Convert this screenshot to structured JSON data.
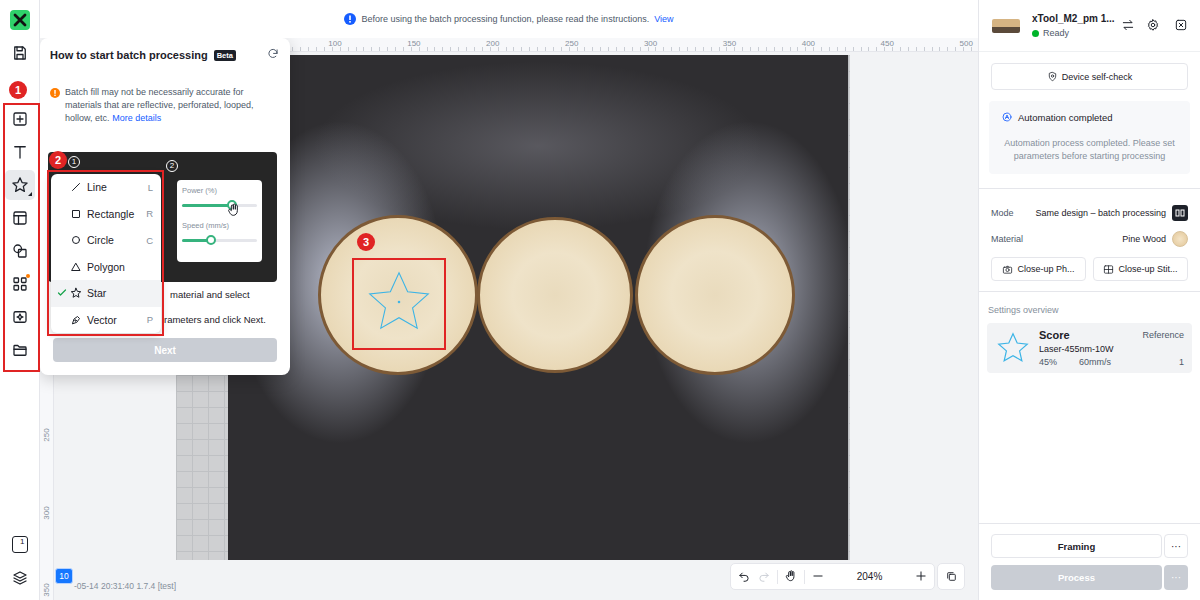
{
  "notice": {
    "text": "Before using the batch processing function, please read the instructions.",
    "link": "View"
  },
  "toolbar": {
    "items": [
      {
        "kind": "add",
        "selected": false
      },
      {
        "kind": "text",
        "selected": false
      },
      {
        "kind": "shape",
        "selected": true
      },
      {
        "kind": "layout",
        "selected": false
      },
      {
        "kind": "combine",
        "selected": false
      },
      {
        "kind": "apps",
        "selected": false
      },
      {
        "kind": "ai",
        "selected": false
      },
      {
        "kind": "folder",
        "selected": false
      }
    ],
    "page_count": "1"
  },
  "annotations": [
    "1",
    "2",
    "3"
  ],
  "popup": {
    "title": "How to start batch processing",
    "badge": "Beta",
    "warning": "Batch fill may not be necessarily accurate for materials that are reflective, perforated, looped, hollow, etc.",
    "more_link": "More details",
    "steps": [
      "1",
      "2"
    ],
    "menu": [
      {
        "kind": "line",
        "label": "Line",
        "shortcut": "L",
        "selected": false
      },
      {
        "kind": "rectangle",
        "label": "Rectangle",
        "shortcut": "R",
        "selected": false
      },
      {
        "kind": "circle",
        "label": "Circle",
        "shortcut": "C",
        "selected": false
      },
      {
        "kind": "polygon",
        "label": "Polygon",
        "selected": false
      },
      {
        "kind": "star",
        "label": "Star",
        "selected": true
      },
      {
        "kind": "vector",
        "label": "Vector",
        "shortcut": "P",
        "selected": false
      }
    ],
    "power": {
      "label": "Power (%)",
      "level": 0.67
    },
    "speed": {
      "label": "Speed (mm/s)",
      "level": 0.39
    },
    "instructions": [
      "material and select",
      "rameters and click Next."
    ],
    "next": {
      "label": "Next",
      "disabled": true
    }
  },
  "ruler": {
    "top": [
      "100",
      "150",
      "200",
      "250",
      "300",
      "350",
      "400",
      "450",
      "500"
    ],
    "left": [
      "250",
      "300",
      "350"
    ]
  },
  "history": {
    "undo_disabled": false,
    "redo_disabled": true
  },
  "zoom": {
    "level": "204%"
  },
  "status": {
    "count": "10",
    "timestamp": "-05-14 20:31:40 1.7.4 [test]"
  },
  "device": {
    "name": "xTool_M2_pm 1...",
    "status": "Ready"
  },
  "self_check": "Device self-check",
  "automation": {
    "title": "Automation completed",
    "message": "Automation process completed. Please set parameters before starting processing"
  },
  "settings": [
    {
      "kind": "mode",
      "label": "Mode",
      "value": "Same design – batch processing"
    },
    {
      "kind": "material",
      "label": "Material",
      "value": "Pine Wood"
    }
  ],
  "closeups": [
    "Close-up Ph...",
    "Close-up Stit..."
  ],
  "overview": {
    "title": "Settings overview",
    "items": [
      {
        "name": "Score",
        "tag": "Reference",
        "laser": "Laser-455nm-10W",
        "power": "45%",
        "speed": "60mm/s",
        "passes": "1"
      }
    ]
  },
  "framing": {
    "label": "Framing",
    "more": "···"
  },
  "process": {
    "label": "Process",
    "more": "···",
    "disabled": true
  }
}
